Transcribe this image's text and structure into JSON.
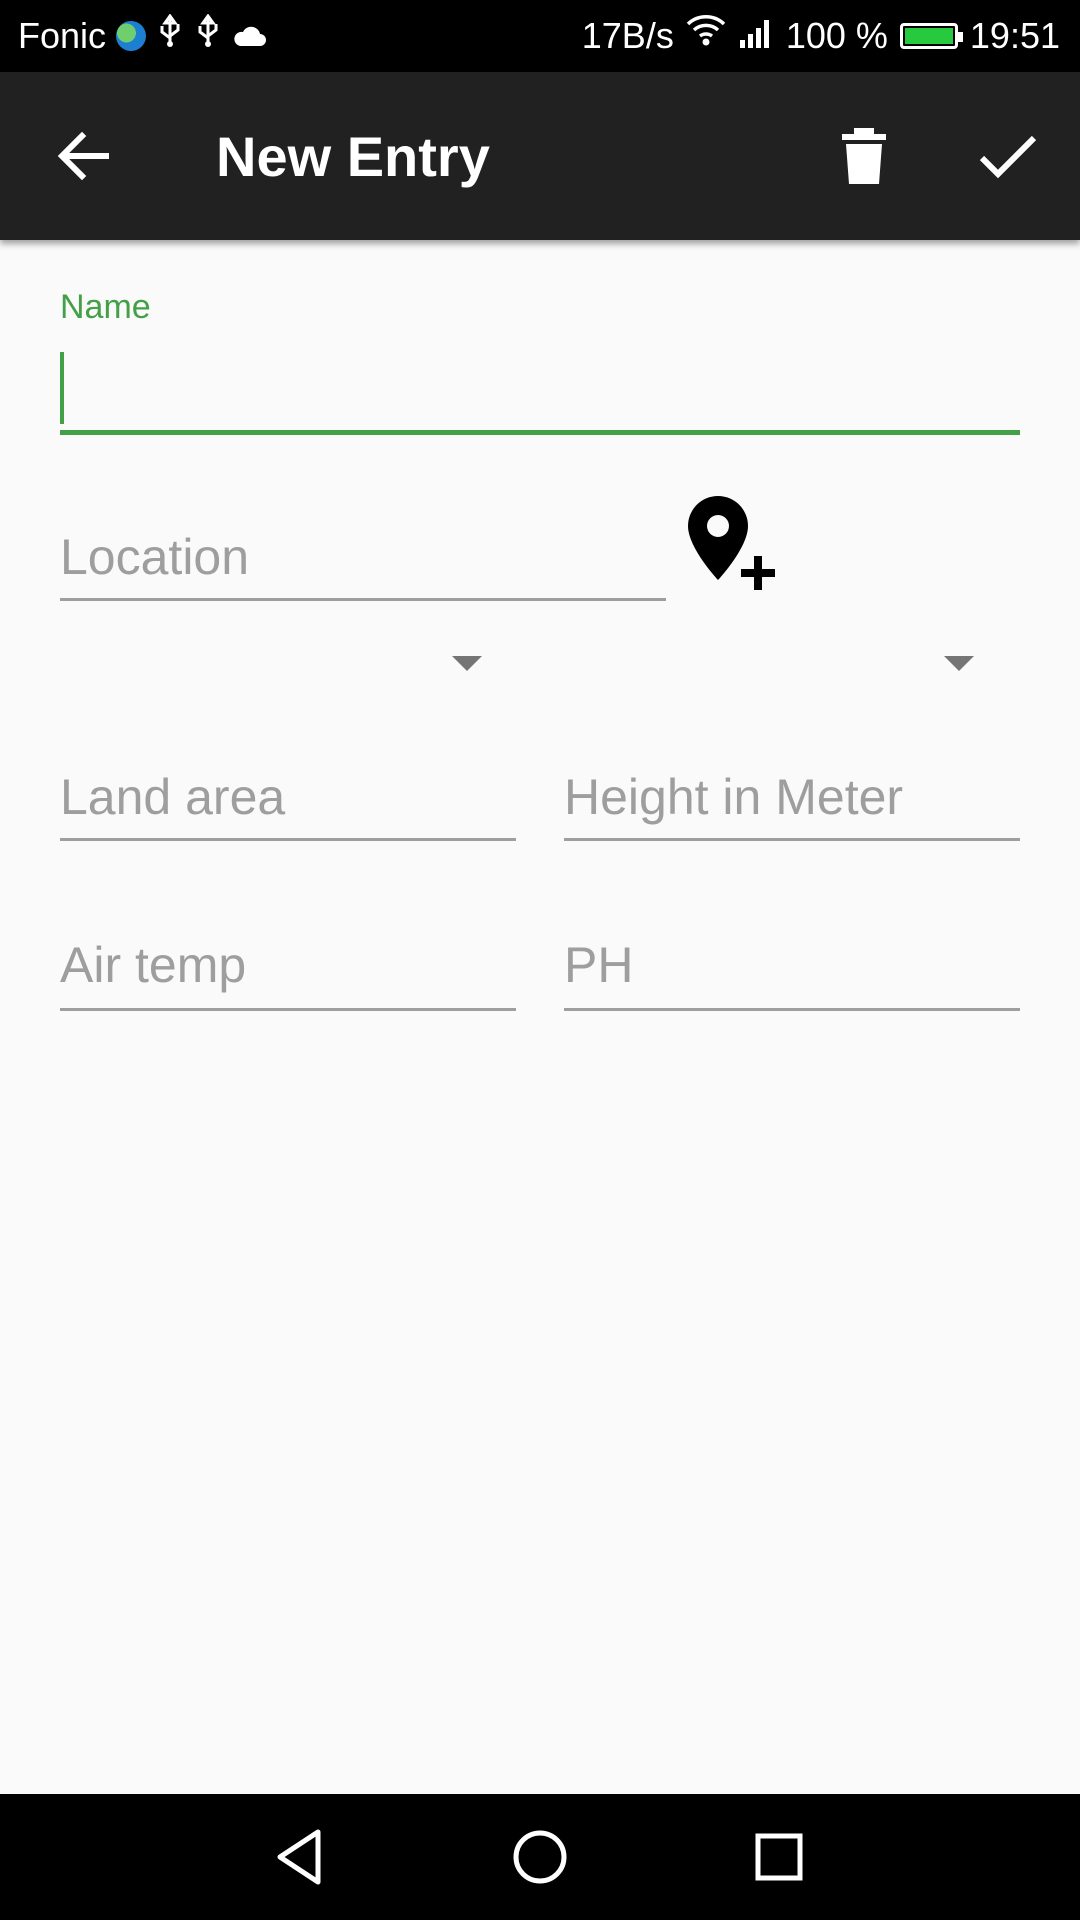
{
  "status_bar": {
    "carrier": "Fonic",
    "speed": "17B/s",
    "battery": "100 %",
    "time": "19:51"
  },
  "app_bar": {
    "title": "New Entry",
    "icons": [
      "back-arrow-icon",
      "trash-icon",
      "checkmark-icon"
    ]
  },
  "form": {
    "name_label": "Name",
    "name_value": "",
    "location_placeholder": "Location",
    "land_area_placeholder": "Land area",
    "height_placeholder": "Height in Meter",
    "air_temp_placeholder": "Air temp",
    "ph_placeholder": "PH",
    "accent_color": "#43a047"
  }
}
